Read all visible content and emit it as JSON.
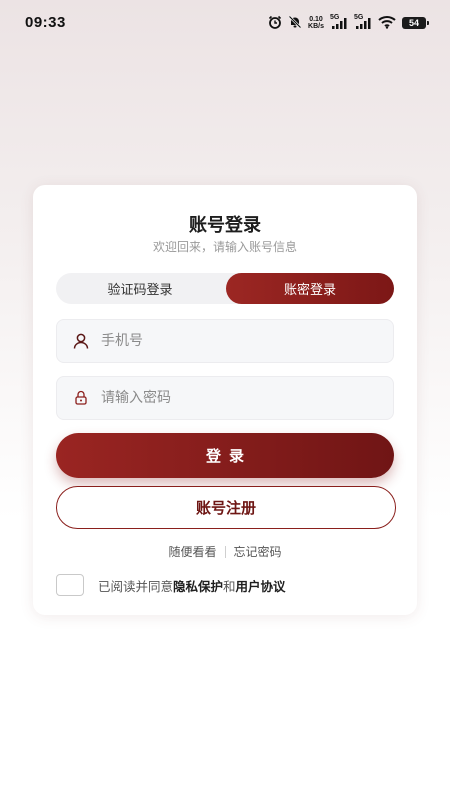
{
  "status_bar": {
    "time": "09:33",
    "net_speed_value": "0.10",
    "net_speed_unit": "KB/s",
    "signal_1_label": "5G",
    "signal_2_label": "5G",
    "battery_level": "54"
  },
  "card": {
    "title": "账号登录",
    "subtitle": "欢迎回来，请输入账号信息",
    "tabs": [
      {
        "label": "验证码登录",
        "active": false
      },
      {
        "label": "账密登录",
        "active": true
      }
    ],
    "phone_field": {
      "placeholder": "手机号",
      "value": ""
    },
    "password_field": {
      "placeholder": "请输入密码",
      "value": ""
    },
    "login_button": "登录",
    "register_button": "账号注册",
    "links": {
      "browse": "随便看看",
      "forgot_password": "忘记密码"
    },
    "agreement": {
      "prefix": "已阅读并同意",
      "privacy": "隐私保护",
      "conjunction": "和",
      "user_agreement": "用户协议",
      "checked": false
    }
  },
  "colors": {
    "accent": "#8b1e1c",
    "accent_dark": "#701515",
    "background_top": "#ece3e4",
    "card": "#ffffff"
  }
}
